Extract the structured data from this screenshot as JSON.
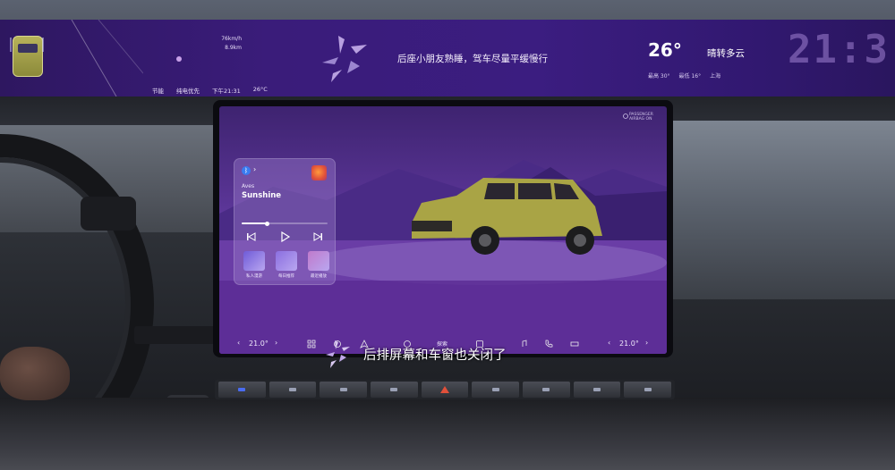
{
  "hud": {
    "stats_title": "",
    "stats": [
      {
        "label": "",
        "value": "76km/h"
      },
      {
        "label": "",
        "value": "8.9km"
      }
    ],
    "mode_note": "",
    "bottom_items": [
      "节能",
      "纯电优先",
      "下午21:31",
      "26°C"
    ],
    "message": "后座小朋友熟睡，驾车尽量平缓慢行",
    "temperature": "26°",
    "weather": "晴转多云",
    "high": "最高 30°",
    "low": "最低 16°",
    "location": "上海",
    "clock": "21:3"
  },
  "screen": {
    "airbag_line1": "PASSENGER",
    "airbag_line2": "AIRBAG",
    "airbag_status": "ON",
    "media": {
      "artist": "Aves",
      "song": "Sunshine",
      "progress": 0.3,
      "tiles": [
        {
          "label": "私人漫游",
          "color": "#6f5bd8"
        },
        {
          "label": "每日推荐",
          "color": "#8b6fe0"
        },
        {
          "label": "最近播放",
          "color": "#c07acb"
        }
      ]
    },
    "bottom_bar": {
      "temp_left": "21.0°",
      "temp_right": "21.0°",
      "center_label": "探索"
    }
  },
  "subtitle": "后排屏幕和车窗也关闭了",
  "colors": {
    "hud_bg": "#3a1c7a",
    "screen_bg": "#5a3596",
    "accent": "#3a7cf0",
    "alert_key": "#e0503a"
  }
}
